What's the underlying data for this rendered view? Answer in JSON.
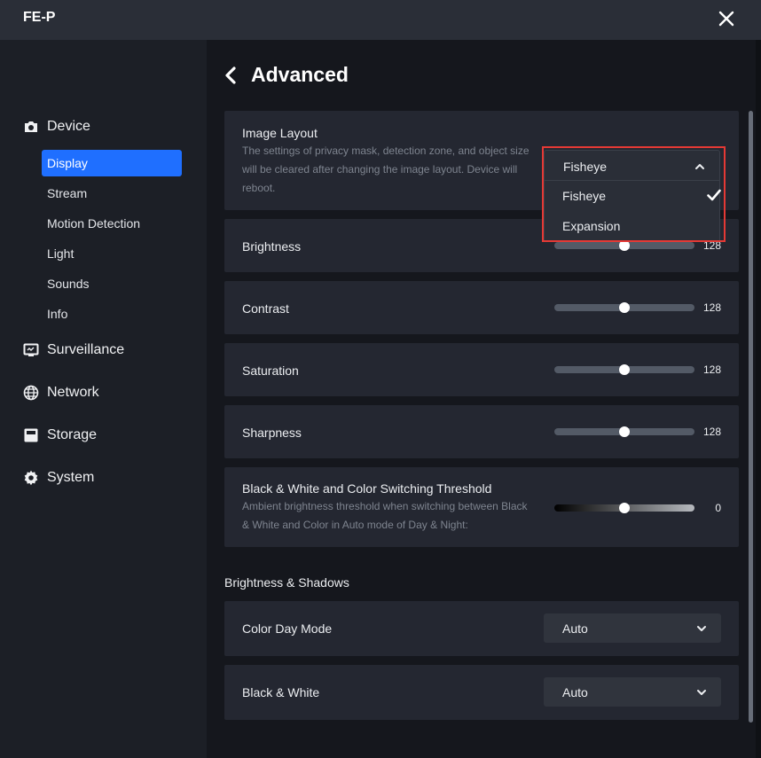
{
  "window": {
    "title": "FE-P"
  },
  "sidebar": {
    "groups": [
      {
        "label": "Device",
        "icon": "camera-icon"
      },
      {
        "label": "Surveillance",
        "icon": "monitor-icon"
      },
      {
        "label": "Network",
        "icon": "globe-icon"
      },
      {
        "label": "Storage",
        "icon": "storage-icon"
      },
      {
        "label": "System",
        "icon": "gear-icon"
      }
    ],
    "device_items": [
      {
        "label": "Display",
        "active": true
      },
      {
        "label": "Stream"
      },
      {
        "label": "Motion Detection"
      },
      {
        "label": "Light"
      },
      {
        "label": "Sounds"
      },
      {
        "label": "Info"
      }
    ]
  },
  "main": {
    "title": "Advanced",
    "image_layout": {
      "label": "Image Layout",
      "description": "The settings of privacy mask, detection zone, and object size will be cleared after changing the image layout. Device will reboot.",
      "selected": "Fisheye",
      "options": [
        "Fisheye",
        "Expansion"
      ]
    },
    "sliders": [
      {
        "label": "Brightness",
        "value": 128,
        "max": 255
      },
      {
        "label": "Contrast",
        "value": 128,
        "max": 255
      },
      {
        "label": "Saturation",
        "value": 128,
        "max": 255
      },
      {
        "label": "Sharpness",
        "value": 128,
        "max": 255
      }
    ],
    "threshold": {
      "label": "Black & White and Color Switching Threshold",
      "description": "Ambient brightness threshold when switching between Black & White and Color in Auto mode of Day & Night:",
      "value": 0
    },
    "section_title": "Brightness & Shadows",
    "color_day_mode": {
      "label": "Color Day Mode",
      "value": "Auto"
    },
    "black_white": {
      "label": "Black & White",
      "value": "Auto"
    }
  },
  "colors": {
    "accent": "#1f6fff",
    "highlight": "#e53935",
    "panel": "#242731"
  }
}
